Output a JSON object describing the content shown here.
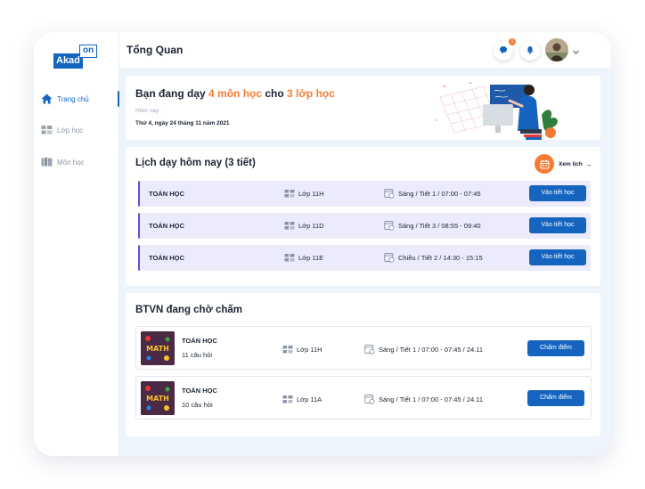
{
  "brand": {
    "logo_main": "Akad",
    "logo_box": "on"
  },
  "sidebar": {
    "items": [
      {
        "label": "Trang chủ",
        "icon": "home-icon",
        "active": true
      },
      {
        "label": "Lớp học",
        "icon": "classroom-icon",
        "active": false
      },
      {
        "label": "Môn học",
        "icon": "book-icon",
        "active": false
      }
    ]
  },
  "header": {
    "title": "Tổng Quan",
    "message_badge": "1",
    "icons": [
      "chat-icon",
      "bell-icon",
      "chevron-down-icon"
    ]
  },
  "welcome": {
    "prefix": "Bạn đang dạy ",
    "subjects_count": "4 môn học",
    "middle": " cho ",
    "classes_count": "3 lớp học",
    "today_label": "Hôm nay:",
    "today_date": "Thứ 4, ngày 24 tháng 11 năm 2021"
  },
  "schedule": {
    "title": "Lịch dạy hôm nay (3 tiết)",
    "view_label": "Xem lịch",
    "action_label": "Vào tiết học",
    "lessons": [
      {
        "subject": "TOÁN HỌC",
        "class": "Lớp 11H",
        "time": "Sáng / Tiết 1 / 07:00 - 07:45"
      },
      {
        "subject": "TOÁN HỌC",
        "class": "Lớp 11D",
        "time": "Sáng / Tiết 3 / 08:55 - 09:40"
      },
      {
        "subject": "TOÁN HỌC",
        "class": "Lớp 11E",
        "time": "Chiều / Tiết 2 / 14:30 - 15:15"
      }
    ]
  },
  "btvn": {
    "title": "BTVN đang chờ chấm",
    "action_label": "Chấm điểm",
    "items": [
      {
        "subject": "TOÁN HỌC",
        "questions": "11 câu hỏi",
        "class": "Lớp 11H",
        "time": "Sáng / Tiết 1 / 07:00 - 07:45 / 24.11",
        "thumb_text": "MATH"
      },
      {
        "subject": "TOÁN HỌC",
        "questions": "10 câu hỏi",
        "class": "Lớp 11A",
        "time": "Sáng / Tiết 1 / 07:00 - 07:45 / 24.11",
        "thumb_text": "MATH"
      }
    ]
  },
  "colors": {
    "primary": "#1565c0",
    "accent": "#f47b35",
    "row_bg": "#ecebfb",
    "row_border": "#6750d0",
    "main_bg": "#eef4fb"
  }
}
